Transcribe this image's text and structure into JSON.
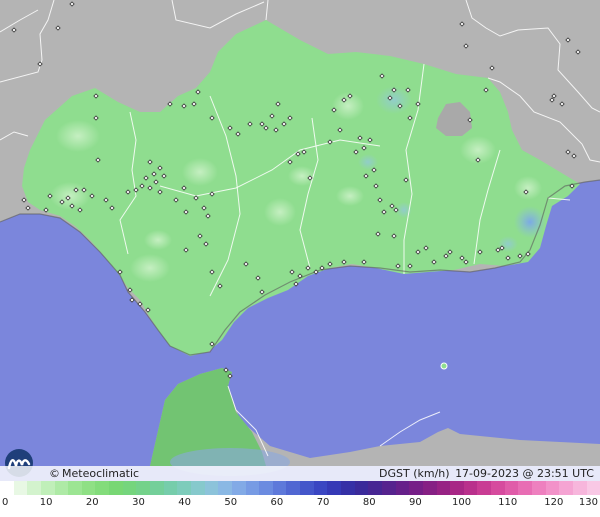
{
  "map": {
    "colors": {
      "sea": "#7b86dc",
      "land_outside": "#b4b4b4",
      "region": "#8fdd8f",
      "africa": "#72c472",
      "low_wind_spot": "#b8e9b4",
      "high_wind_spot": "#8ab8e8",
      "no_data": "#9e9e9e",
      "border": "#ffffff",
      "station": "#ffffff"
    }
  },
  "branding": {
    "copyright": "©",
    "name": "Meteoclimatic"
  },
  "info": {
    "variable": "DGST (km/h)",
    "datetime": "17-09-2023 @ 23:51 UTC"
  },
  "scale": {
    "colors": [
      "#ffffff",
      "#e8f8e4",
      "#d3f3cd",
      "#c0efb9",
      "#aeeaa6",
      "#9ce593",
      "#8fe085",
      "#83dc7b",
      "#78d774",
      "#75d57d",
      "#74d28a",
      "#74cf9a",
      "#76cdab",
      "#7dccbb",
      "#86c9cc",
      "#8cc3da",
      "#8ab8e4",
      "#82aae6",
      "#779be4",
      "#6b8be0",
      "#5e79da",
      "#5167d2",
      "#4456ca",
      "#3a46c2",
      "#3539b6",
      "#3530a6",
      "#3a2a9a",
      "#472693",
      "#56238e",
      "#66208a",
      "#761f87",
      "#862084",
      "#972284",
      "#a82786",
      "#b9308c",
      "#c93c94",
      "#d64b9e",
      "#e05ca9",
      "#e86db4",
      "#ee80bf",
      "#f292c9",
      "#f5a4d3",
      "#f7b6dc",
      "#f9c8e5"
    ],
    "ticks": [
      "0",
      "10",
      "20",
      "30",
      "40",
      "50",
      "60",
      "70",
      "80",
      "90",
      "100",
      "110",
      "120",
      "130"
    ]
  }
}
